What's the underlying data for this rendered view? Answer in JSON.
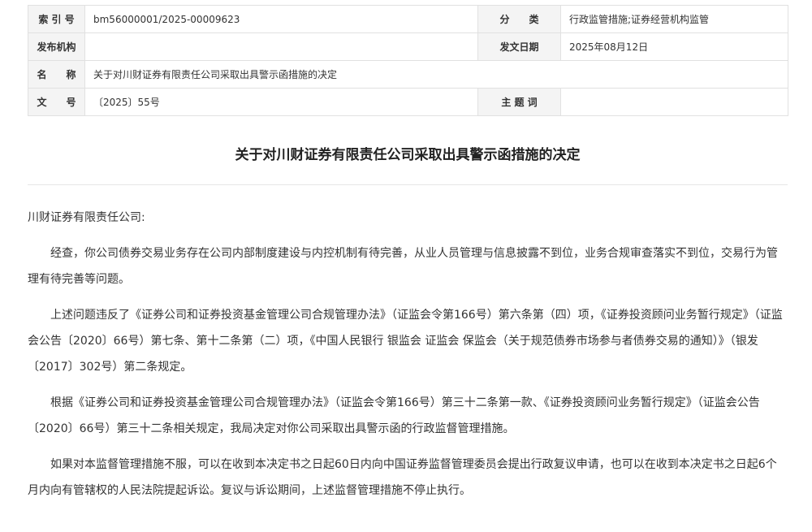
{
  "meta": {
    "index_label": "索 引 号",
    "index_value": "bm56000001/2025-00009623",
    "category_label": "分　　类",
    "category_value": "行政监管措施;证券经营机构监管",
    "issuer_label": "发布机构",
    "issuer_value": "",
    "date_label": "发文日期",
    "date_value": "2025年08月12日",
    "name_label": "名　　称",
    "name_value": "关于对川财证券有限责任公司采取出具警示函措施的决定",
    "docno_label": "文　　号",
    "docno_value": "〔2025〕55号",
    "subject_label": "主 题 词",
    "subject_value": ""
  },
  "document": {
    "title": "关于对川财证券有限责任公司采取出具警示函措施的决定",
    "salutation": "川财证券有限责任公司:",
    "paragraphs": [
      "经查，你公司债券交易业务存在公司内部制度建设与内控机制有待完善，从业人员管理与信息披露不到位，业务合规审查落实不到位，交易行为管理有待完善等问题。",
      "上述问题违反了《证券公司和证券投资基金管理公司合规管理办法》（证监会令第166号）第六条第（四）项，《证券投资顾问业务暂行规定》（证监会公告〔2020〕66号）第七条、第十二条第（二）项，《中国人民银行 银监会 证监会 保监会（关于规范债券市场参与者债券交易的通知）》（银发〔2017〕302号）第二条规定。",
      "根据《证券公司和证券投资基金管理公司合规管理办法》（证监会令第166号）第三十二条第一款、《证券投资顾问业务暂行规定》（证监会公告〔2020〕66号）第三十二条相关规定，我局决定对你公司采取出具警示函的行政监督管理措施。",
      "如果对本监督管理措施不服，可以在收到本决定书之日起60日内向中国证券监督管理委员会提出行政复议申请，也可以在收到本决定书之日起6个月内向有管辖权的人民法院提起诉讼。复议与诉讼期间，上述监督管理措施不停止执行。"
    ]
  }
}
